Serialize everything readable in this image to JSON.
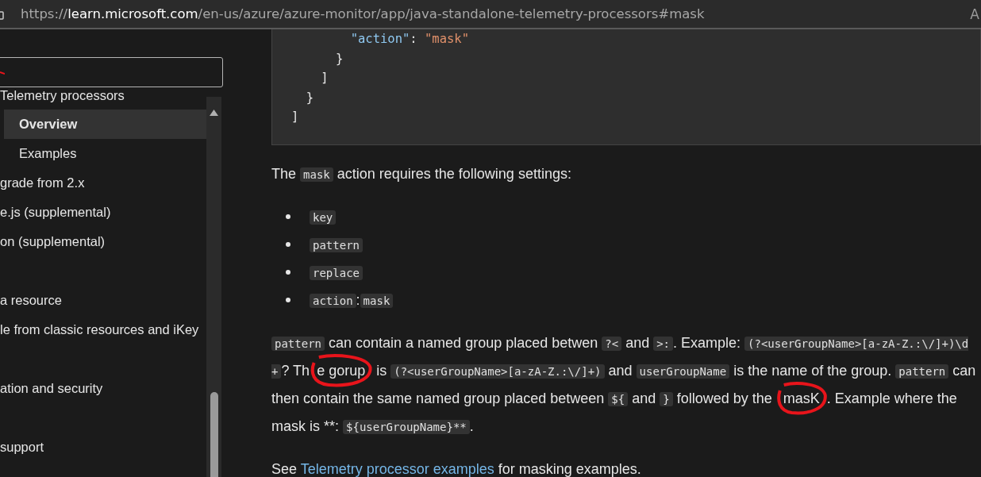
{
  "address_bar": {
    "url_scheme": "https://",
    "url_domain": "learn.microsoft.com",
    "url_path": "/en-us/azure/azure-monitor/app/java-standalone-telemetry-processors#mask",
    "read_aloud": "A"
  },
  "sidebar": {
    "sections": [
      {
        "items": [
          {
            "label": "Telemetry processors",
            "nested": false,
            "selected": false
          },
          {
            "label": "Overview",
            "nested": true,
            "selected": true
          },
          {
            "label": "Examples",
            "nested": true,
            "selected": false
          },
          {
            "label": "grade from 2.x",
            "nested": false,
            "selected": false
          },
          {
            "label": "e.js (supplemental)",
            "nested": false,
            "selected": false
          },
          {
            "label": "on (supplemental)",
            "nested": false,
            "selected": false
          }
        ]
      },
      {
        "items": [
          {
            "label": "a resource",
            "nested": false,
            "selected": false
          },
          {
            "label": "le from classic resources and iKey",
            "nested": false,
            "selected": false
          }
        ]
      },
      {
        "items": [
          {
            "label": "ation and security",
            "nested": false,
            "selected": false
          }
        ]
      },
      {
        "items": [
          {
            "label": "support",
            "nested": false,
            "selected": false
          }
        ]
      }
    ]
  },
  "code_block": {
    "lines": [
      [
        {
          "kind": "key",
          "text": "        \"action\""
        },
        {
          "kind": "plain",
          "text": ": "
        },
        {
          "kind": "string",
          "text": "\"mask\""
        }
      ],
      [
        {
          "kind": "plain",
          "text": "      }"
        }
      ],
      [
        {
          "kind": "plain",
          "text": "    ]"
        }
      ],
      [
        {
          "kind": "plain",
          "text": "  }"
        }
      ],
      [
        {
          "kind": "plain",
          "text": "]"
        }
      ]
    ]
  },
  "intro": [
    {
      "kind": "text",
      "text": "The "
    },
    {
      "kind": "code",
      "text": "mask"
    },
    {
      "kind": "text",
      "text": " action requires the following settings:"
    }
  ],
  "settings": [
    [
      {
        "kind": "code",
        "text": "key"
      }
    ],
    [
      {
        "kind": "code",
        "text": "pattern"
      }
    ],
    [
      {
        "kind": "code",
        "text": "replace"
      }
    ],
    [
      {
        "kind": "code",
        "text": "action"
      },
      {
        "kind": "text",
        "text": ":"
      },
      {
        "kind": "code",
        "text": "mask"
      }
    ]
  ],
  "paragraph": [
    {
      "kind": "code",
      "text": "pattern"
    },
    {
      "kind": "text",
      "text": " can contain a named group placed betwen "
    },
    {
      "kind": "code",
      "text": "?<"
    },
    {
      "kind": "text",
      "text": " and "
    },
    {
      "kind": "code",
      "text": ">:"
    },
    {
      "kind": "text",
      "text": ". Example: "
    },
    {
      "kind": "code",
      "text": "(?<userGroupName>[a-zA-Z.:\\/]+)\\d+"
    },
    {
      "kind": "text",
      "text": "? Th"
    },
    {
      "kind": "text",
      "text": "e gorup",
      "circled": true
    },
    {
      "kind": "text",
      "text": " is "
    },
    {
      "kind": "code",
      "text": "(?<userGroupName>[a-zA-Z.:\\/]+)"
    },
    {
      "kind": "text",
      "text": " and "
    },
    {
      "kind": "code",
      "text": "userGroupName"
    },
    {
      "kind": "text",
      "text": " is the name of the group. "
    },
    {
      "kind": "code",
      "text": "pattern"
    },
    {
      "kind": "text",
      "text": " can then contain the same named group placed between "
    },
    {
      "kind": "code",
      "text": "${"
    },
    {
      "kind": "text",
      "text": " and "
    },
    {
      "kind": "code",
      "text": "}"
    },
    {
      "kind": "text",
      "text": " followed by the "
    },
    {
      "kind": "text",
      "text": "masK",
      "circled": true
    },
    {
      "kind": "text",
      "text": ". Example where the mask is **: "
    },
    {
      "kind": "code",
      "text": "${userGroupName}**"
    },
    {
      "kind": "text",
      "text": "."
    }
  ],
  "see_also": [
    {
      "kind": "text",
      "text": "See "
    },
    {
      "kind": "link",
      "text": "Telemetry processor examples"
    },
    {
      "kind": "text",
      "text": " for masking examples."
    }
  ]
}
